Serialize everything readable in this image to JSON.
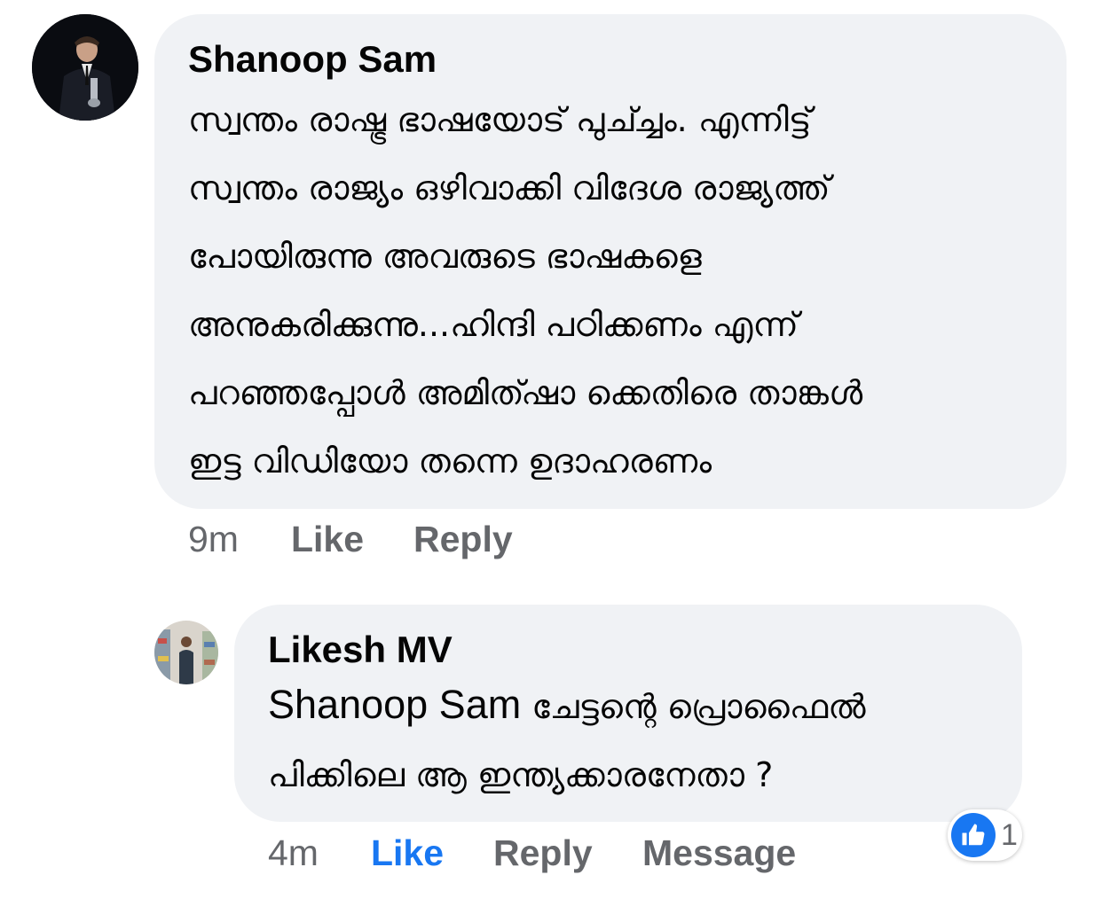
{
  "comments": [
    {
      "author": "Shanoop Sam",
      "text_lines": [
        "സ്വന്തം രാഷ്ട്ര ഭാഷയോട് പുച്ച്ചം. എന്നിട്ട്",
        "സ്വന്തം രാജ്യം ഒഴിവാക്കി വിദേശ രാജ്യത്ത്",
        "പോയിരുന്നു അവരുടെ ഭാഷകളെ",
        "അനുകരിക്കുന്നു...ഹിന്ദി പഠിക്കണം എന്ന്",
        "പറഞ്ഞപ്പോൾ അമിത്ഷാ ക്കെതിരെ താങ്കൾ",
        "ഇട്ട വിഡിയോ തന്നെ ഉദാഹരണം"
      ],
      "time": "9m",
      "like_label": "Like",
      "reply_label": "Reply"
    },
    {
      "author": "Likesh MV",
      "mention": "Shanoop Sam",
      "text_line1_rest": " ചേട്ടന്റെ പ്രൊഫൈൽ",
      "text_line2": "പിക്കിലെ ആ ഇന്ത്യക്കാരനേതാ ?",
      "time": "4m",
      "like_label": "Like",
      "reply_label": "Reply",
      "message_label": "Message",
      "reaction_count": "1"
    }
  ],
  "colors": {
    "bubble": "#f0f2f5",
    "text": "#050505",
    "meta": "#65676b",
    "liked": "#1877f2"
  },
  "icons": {
    "reaction": "like-thumb-icon"
  }
}
